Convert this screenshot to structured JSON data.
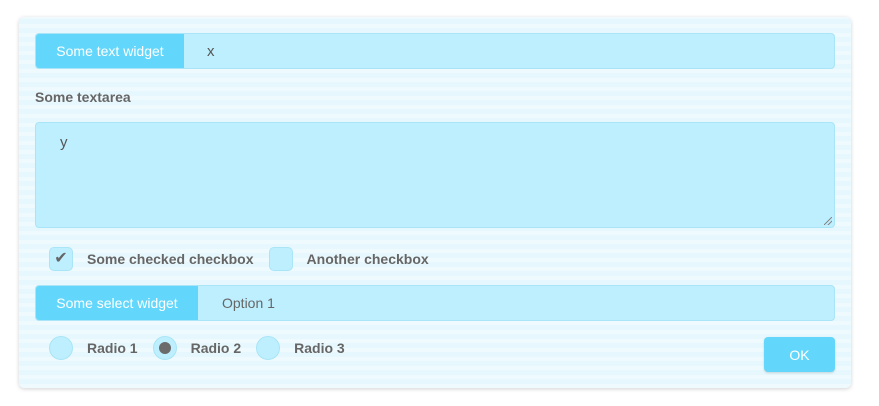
{
  "form": {
    "text_widget": {
      "label": "Some text widget",
      "value": "x"
    },
    "textarea": {
      "label": "Some textarea",
      "value": "y"
    },
    "checkboxes": [
      {
        "label": "Some checked checkbox",
        "checked": true,
        "check_glyph": "✔"
      },
      {
        "label": "Another checkbox",
        "checked": false,
        "check_glyph": ""
      }
    ],
    "select_widget": {
      "label": "Some select widget",
      "selected": "Option 1"
    },
    "radios": [
      {
        "label": "Radio 1",
        "selected": false
      },
      {
        "label": "Radio 2",
        "selected": true
      },
      {
        "label": "Radio 3",
        "selected": false
      }
    ],
    "ok_label": "OK"
  },
  "colors": {
    "accent": "#63d7fb",
    "field_bg": "#bdefff",
    "panel_bg": "#e6f8fd",
    "text": "#666666"
  }
}
